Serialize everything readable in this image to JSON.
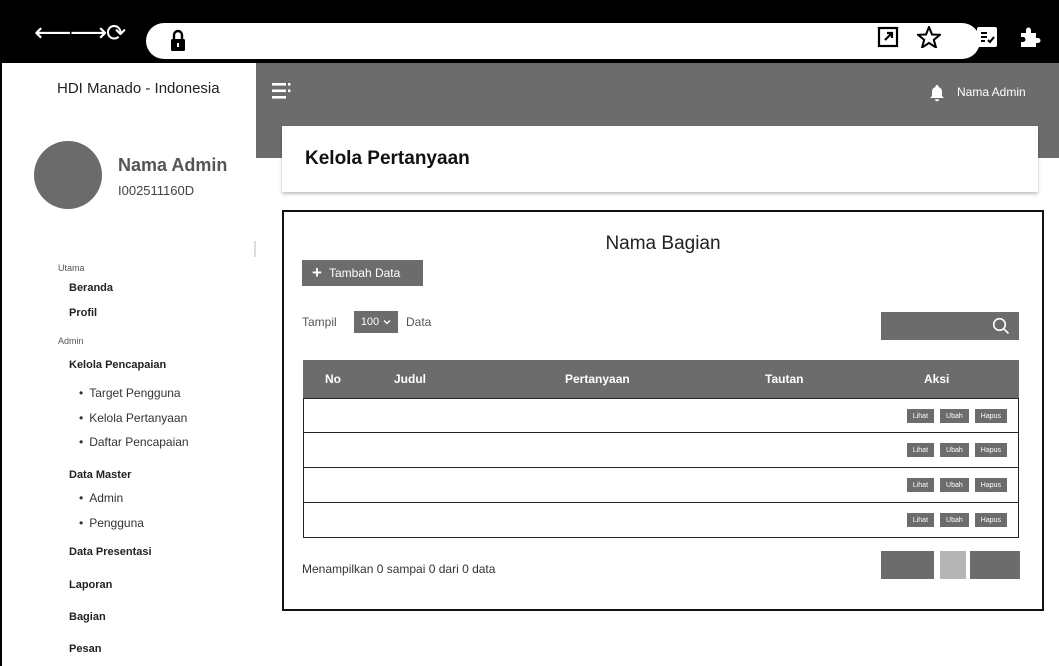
{
  "browser": {
    "back_glyph": "⟵",
    "forward_glyph": "⟶",
    "reload_glyph": "⟳"
  },
  "sidebar": {
    "brand": "HDI Manado - Indonesia",
    "profile": {
      "name": "Nama Admin",
      "id": "I002511160D"
    },
    "sections": [
      {
        "label": "Utama"
      },
      {
        "label": "Admin"
      }
    ],
    "items": {
      "beranda": "Beranda",
      "profil": "Profil",
      "kelola_pencapaian": "Kelola Pencapaian",
      "target_pengguna": "Target Pengguna",
      "kelola_pertanyaan": "Kelola Pertanyaan",
      "daftar_pencapaian": "Daftar Pencapaian",
      "data_master": "Data Master",
      "admin": "Admin",
      "pengguna": "Pengguna",
      "data_presentasi": "Data Presentasi",
      "laporan": "Laporan",
      "bagian": "Bagian",
      "pesan": "Pesan"
    }
  },
  "header": {
    "admin_name": "Nama Admin",
    "icons": [
      "menu-icon",
      "bell-icon"
    ]
  },
  "page": {
    "title": "Kelola Pertanyaan",
    "section_title": "Nama Bagian",
    "add_button": "Tambah Data",
    "show_label": "Tampil",
    "show_value": "100",
    "show_unit": "Data",
    "summary": "Menampilkan 0 sampai 0 dari 0 data"
  },
  "table": {
    "headers": {
      "no": "No",
      "judul": "Judul",
      "pertanyaan": "Pertanyaan",
      "tautan": "Tautan",
      "aksi": "Aksi"
    },
    "actions": {
      "view": "Lihat",
      "edit": "Ubah",
      "delete": "Hapus"
    },
    "row_count": 4
  },
  "colors": {
    "primary_gray": "#6c6c6c",
    "pager_light": "#b5b5b5",
    "browser_bar": "#000000"
  }
}
